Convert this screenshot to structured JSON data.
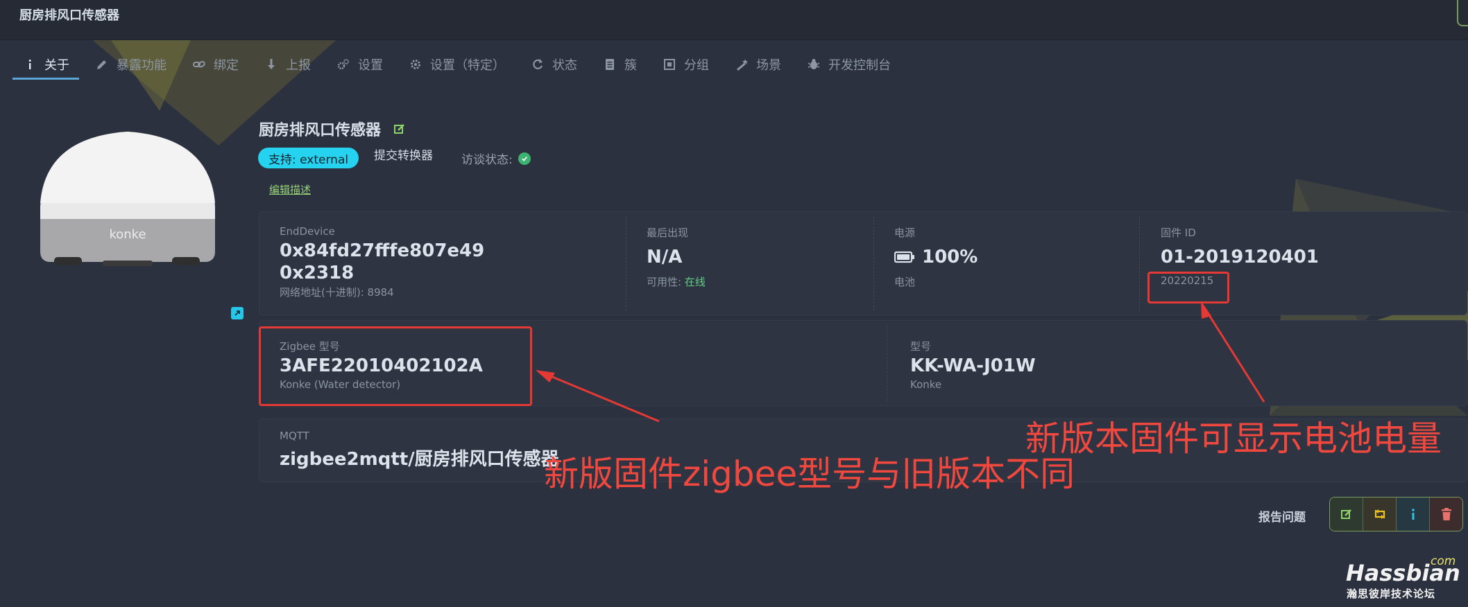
{
  "window": {
    "title": "厨房排风口传感器"
  },
  "tabs": [
    {
      "label": "关于",
      "icon": "info-icon",
      "active": true
    },
    {
      "label": "暴露功能",
      "icon": "pencil-icon"
    },
    {
      "label": "绑定",
      "icon": "link-icon"
    },
    {
      "label": "上报",
      "icon": "download-icon"
    },
    {
      "label": "设置",
      "icon": "gears-icon"
    },
    {
      "label": "设置（特定）",
      "icon": "gear-icon"
    },
    {
      "label": "状态",
      "icon": "refresh-icon"
    },
    {
      "label": "簇",
      "icon": "document-icon"
    },
    {
      "label": "分组",
      "icon": "frame-icon"
    },
    {
      "label": "场景",
      "icon": "magic-icon"
    },
    {
      "label": "开发控制台",
      "icon": "bug-icon"
    }
  ],
  "device": {
    "name": "厨房排风口传感器",
    "image_brand": "konke",
    "support_label": "支持: external",
    "submit_converter": "提交转换器",
    "interview_label": "访谈状态:",
    "edit_description": "编辑描述"
  },
  "info_row1": {
    "type_label": "EndDevice",
    "ieee": "0x84fd27fffe807e49",
    "nwk_hex": "0x2318",
    "nwk_dec_label": "网络地址(十进制): 8984",
    "last_seen_label": "最后出现",
    "last_seen_value": "N/A",
    "availability_label": "可用性: ",
    "availability_value": "在线",
    "power_label": "电源",
    "power_value": "100%",
    "power_sub": "电池",
    "firmware_label": "固件 ID",
    "firmware_value": "01-2019120401",
    "firmware_date": "20220215"
  },
  "info_row2": {
    "zigbee_model_label": "Zigbee 型号",
    "zigbee_model_value": "3AFE22010402102A",
    "zigbee_model_sub": "Konke (Water detector)",
    "model_label": "型号",
    "model_value": "KK-WA-J01W",
    "model_vendor": "Konke"
  },
  "info_row3": {
    "mqtt_label": "MQTT",
    "mqtt_value": "zigbee2mqtt/厨房排风口传感器"
  },
  "annotations": {
    "zigbee_note": "新版固件zigbee型号与旧版本不同",
    "battery_note": "新版本固件可显示电池电量"
  },
  "footer": {
    "report_issue": "报告问题",
    "buttons": [
      "edit-icon",
      "swap-icon",
      "info-icon",
      "trash-icon"
    ]
  },
  "watermark": {
    "brand": "Hassbian",
    "com": "com",
    "subtitle": "瀚思彼岸技术论坛"
  },
  "colors": {
    "background": "#2b313e",
    "accent_cyan": "#25d3f1",
    "success_green": "#5fd183",
    "annotation_red": "#e53935",
    "triangle_olive": "#6f6d3a"
  }
}
